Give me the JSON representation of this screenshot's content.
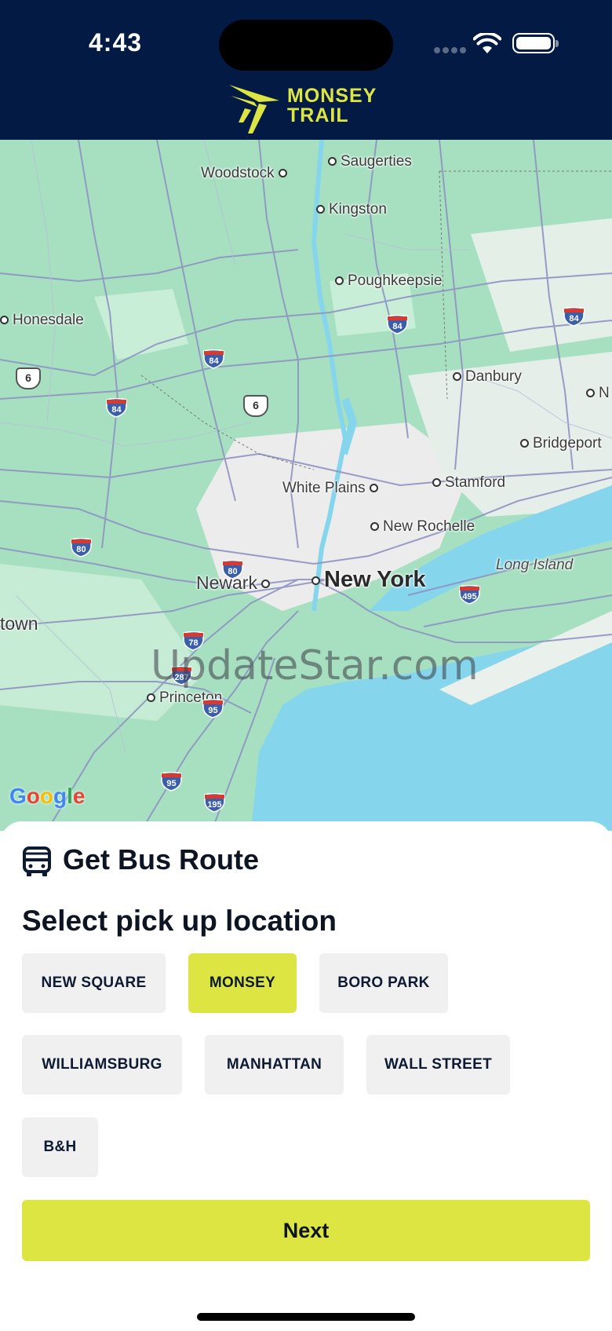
{
  "status_bar": {
    "time": "4:43"
  },
  "header": {
    "logo_line1": "MONSEY",
    "logo_line2": "TRAIL",
    "brand_color": "#dde543",
    "bg_color": "#031a44"
  },
  "map": {
    "cities": {
      "saugerties": "Saugerties",
      "woodstock": "Woodstock",
      "kingston": "Kingston",
      "poughkeepsie": "Poughkeepsie",
      "honesdale": "Honesdale",
      "danbury": "Danbury",
      "bridgeport": "Bridgeport",
      "white_plains": "White Plains",
      "stamford": "Stamford",
      "new_rochelle": "New Rochelle",
      "long_island": "Long Island",
      "newark": "Newark",
      "new_york": "New York",
      "town": "town",
      "princeton": "Princeton",
      "n_cut": "N"
    },
    "shields": {
      "i84_a": "84",
      "i84_b": "84",
      "i84_c": "84",
      "i84_d": "84",
      "i80_a": "80",
      "i80_b": "80",
      "i78": "78",
      "i287": "287",
      "i95_a": "95",
      "i95_b": "95",
      "i195": "195",
      "i495": "495",
      "us6_a": "6",
      "us6_b": "6"
    },
    "watermark": "UpdateStar.com",
    "attribution": {
      "g1": "G",
      "g2": "o",
      "g3": "o",
      "g4": "g",
      "g5": "l",
      "g6": "e"
    }
  },
  "panel": {
    "title": "Get Bus Route",
    "section_title": "Select pick up location",
    "locations": {
      "new_square": "NEW SQUARE",
      "monsey": "MONSEY",
      "boro_park": "BORO PARK",
      "williamsburg": "WILLIAMSBURG",
      "manhattan": "MANHATTAN",
      "wall_street": "WALL STREET",
      "bh": "B&H"
    },
    "selected_location": "MONSEY",
    "next_label": "Next"
  }
}
